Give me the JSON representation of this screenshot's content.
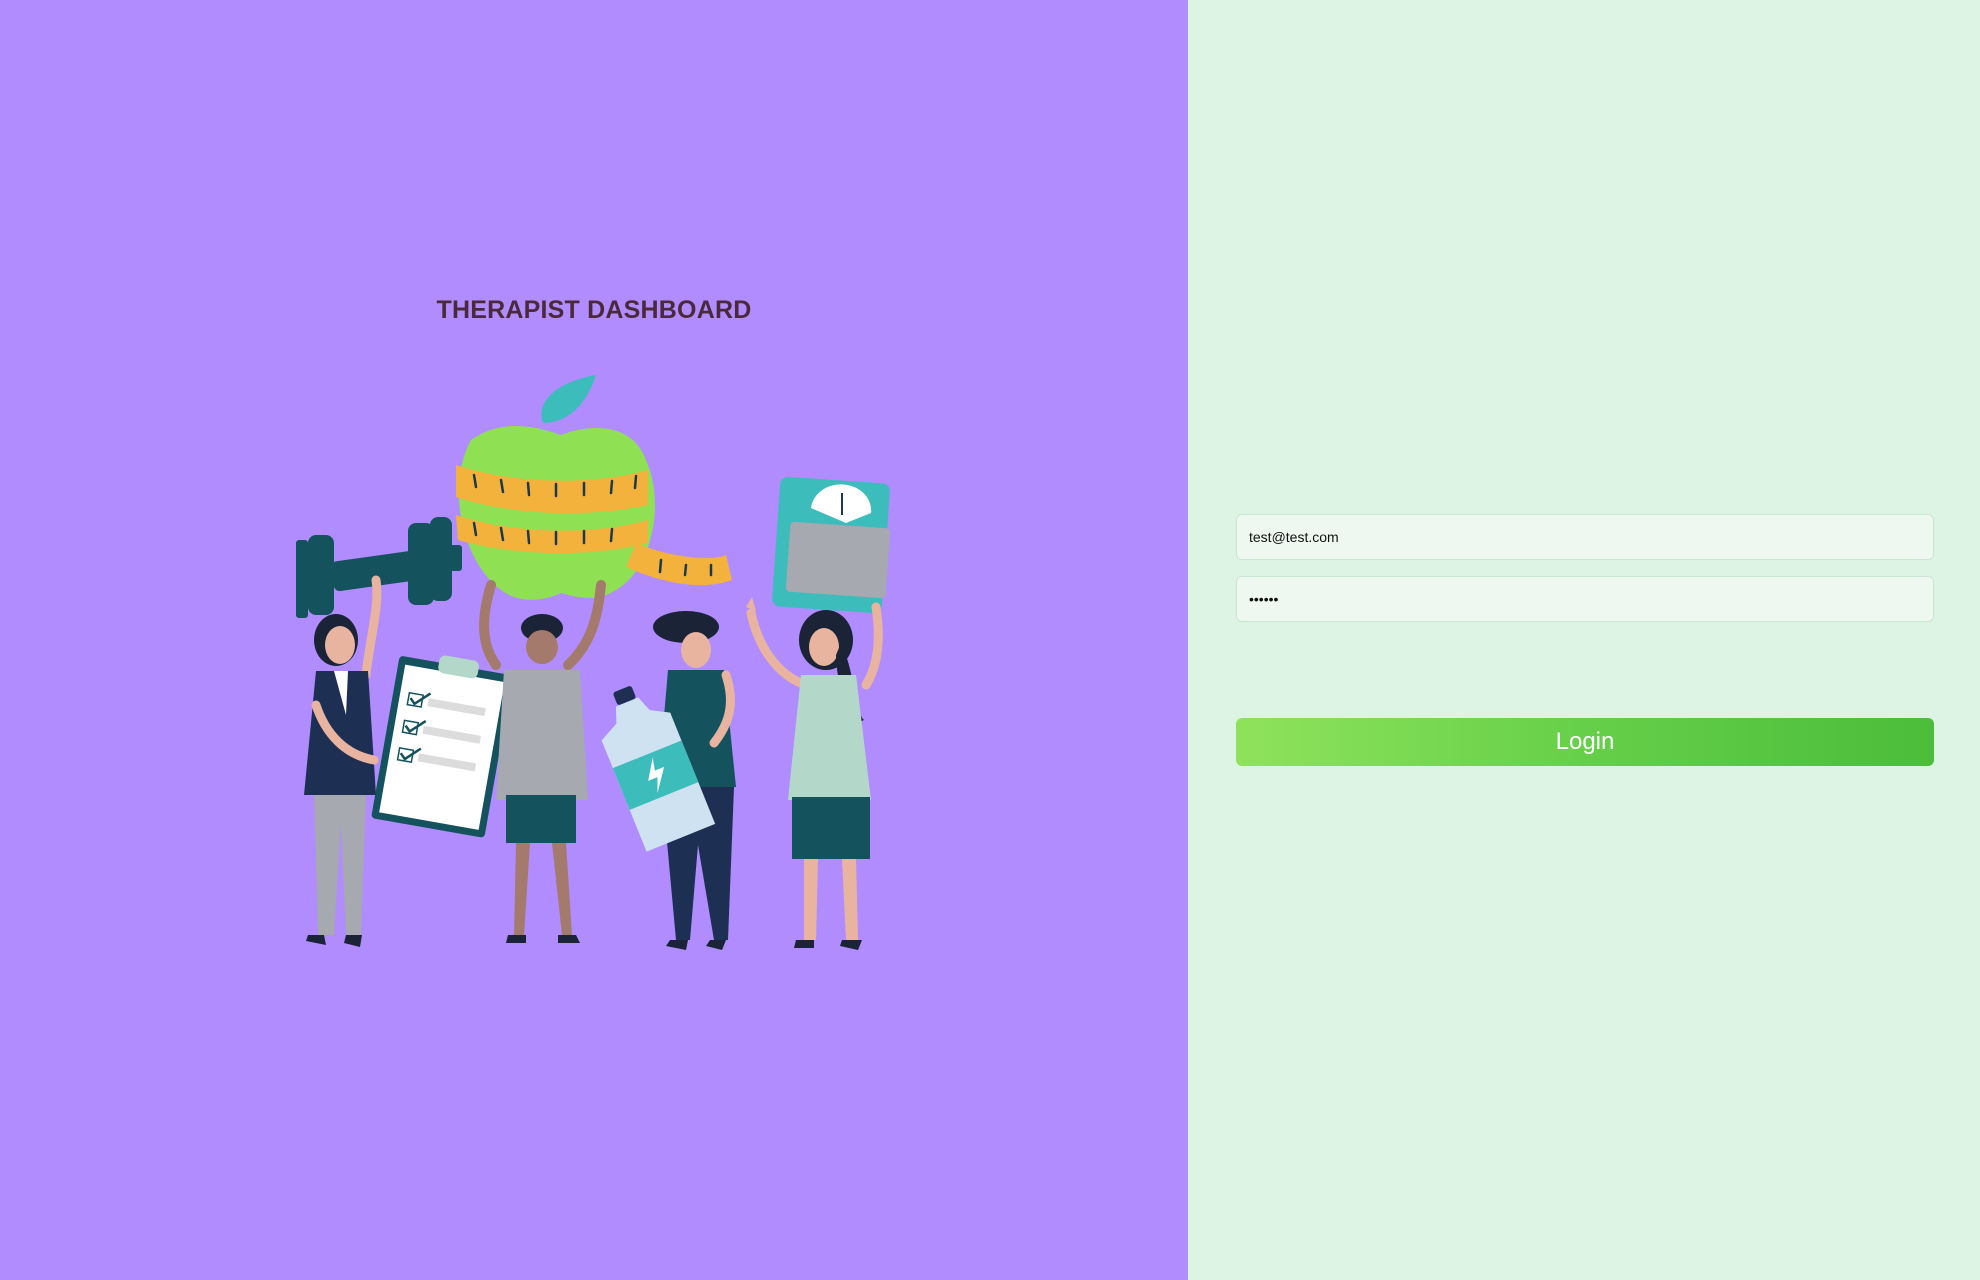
{
  "left_panel": {
    "title": "THERAPIST DASHBOARD",
    "background_color": "#b08cff",
    "illustration": "fitness-group-illustration"
  },
  "login": {
    "email_value": "test@test.com",
    "password_value": "••••••",
    "button_label": "Login",
    "background_color": "#ddf3e4",
    "button_gradient": [
      "#8fe35b",
      "#4bbd3a"
    ]
  }
}
